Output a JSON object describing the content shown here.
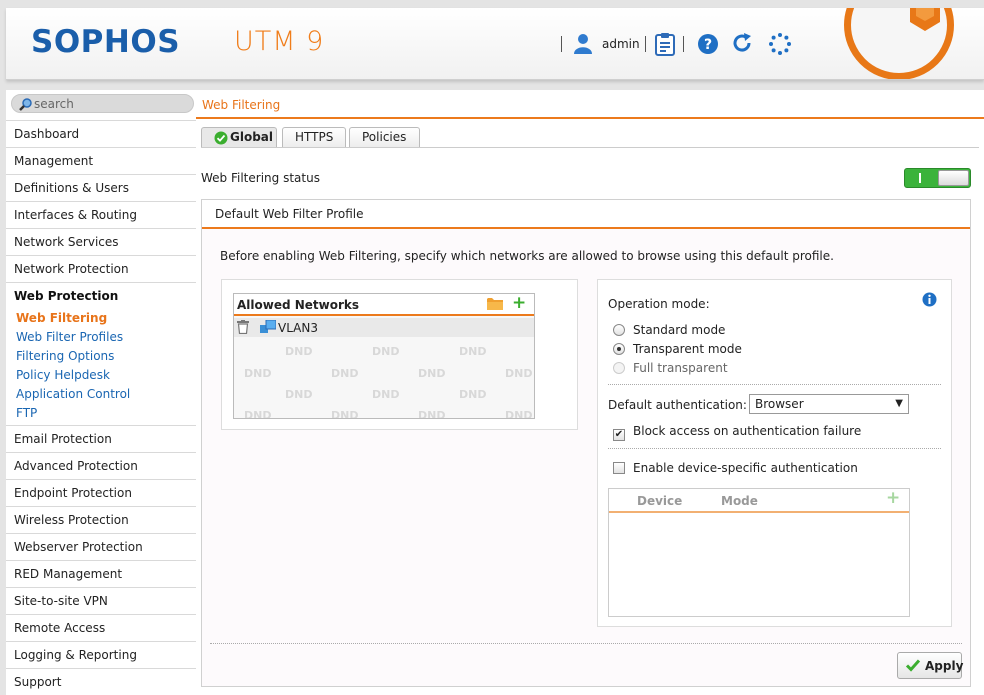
{
  "header": {
    "brand": "SOPHOS",
    "product": "UTM 9",
    "username": "admin",
    "icons": [
      "user-icon",
      "clipboard-icon",
      "help-icon",
      "reload-icon",
      "spinner-icon",
      "emblem-logo"
    ]
  },
  "search": {
    "placeholder": "search"
  },
  "menu": {
    "items": [
      {
        "label": "Dashboard"
      },
      {
        "label": "Management"
      },
      {
        "label": "Definitions & Users"
      },
      {
        "label": "Interfaces & Routing"
      },
      {
        "label": "Network Services"
      },
      {
        "label": "Network Protection"
      },
      {
        "label": "Web Protection"
      },
      {
        "label": "Email Protection"
      },
      {
        "label": "Advanced Protection"
      },
      {
        "label": "Endpoint Protection"
      },
      {
        "label": "Wireless Protection"
      },
      {
        "label": "Webserver Protection"
      },
      {
        "label": "RED Management"
      },
      {
        "label": "Site-to-site VPN"
      },
      {
        "label": "Remote Access"
      },
      {
        "label": "Logging & Reporting"
      },
      {
        "label": "Support"
      }
    ],
    "web_protection_sub": [
      {
        "label": "Web Filtering"
      },
      {
        "label": "Web Filter Profiles"
      },
      {
        "label": "Filtering Options"
      },
      {
        "label": "Policy Helpdesk"
      },
      {
        "label": "Application Control"
      },
      {
        "label": "FTP"
      }
    ]
  },
  "breadcrumb": "Web Filtering",
  "tabs": [
    {
      "label": "Global"
    },
    {
      "label": "HTTPS"
    },
    {
      "label": "Policies"
    }
  ],
  "status": {
    "label": "Web Filtering status",
    "enabled": true
  },
  "panel": {
    "title": "Default Web Filter Profile",
    "intro": "Before enabling Web Filtering, specify which networks are allowed to browse using this default profile.",
    "networks": {
      "title": "Allowed Networks",
      "items": [
        "VLAN3"
      ],
      "watermark": "DND"
    },
    "operation": {
      "label": "Operation mode:",
      "modes": [
        {
          "label": "Standard mode",
          "selected": false,
          "disabled": false
        },
        {
          "label": "Transparent mode",
          "selected": true,
          "disabled": false
        },
        {
          "label": "Full transparent",
          "selected": false,
          "disabled": true
        }
      ],
      "auth_label": "Default authentication:",
      "auth_value": "Browser",
      "block_label": "Block access on authentication failure",
      "block_checked": true,
      "device_label": "Enable device-specific authentication",
      "device_checked": false,
      "device_table": {
        "col_device": "Device",
        "col_mode": "Mode"
      }
    },
    "apply_label": "Apply"
  },
  "colors": {
    "accent": "#ec7a1c",
    "brand_blue": "#1a5eaa",
    "link": "#1a66b2",
    "toggle_on": "#3bb33b"
  }
}
